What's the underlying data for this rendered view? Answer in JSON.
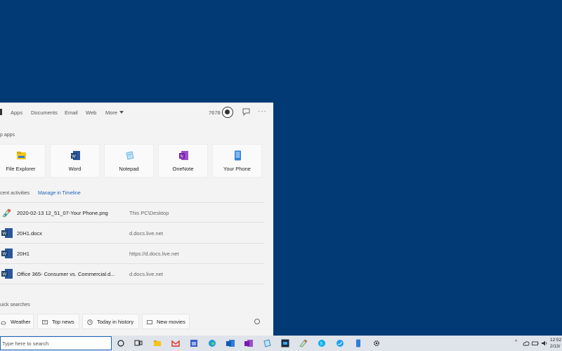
{
  "tabs": {
    "apps": "Apps",
    "documents": "Documents",
    "email": "Email",
    "web": "Web",
    "more": "More"
  },
  "header": {
    "points": "7678"
  },
  "top_apps": {
    "label": "p apps",
    "items": [
      {
        "name": "File Explorer",
        "color": "#f5c518"
      },
      {
        "name": "Word",
        "color": "#2b579a"
      },
      {
        "name": "Notepad",
        "color": "#6fb6e0"
      },
      {
        "name": "OneNote",
        "color": "#7719aa"
      },
      {
        "name": "Your Phone",
        "color": "#2f7fd6"
      }
    ]
  },
  "recent": {
    "label": "cent activities",
    "manage": "Manage in Timeline",
    "items": [
      {
        "title": "2020-02-13 12_51_07-Your Phone.png",
        "location": "This PC\\Desktop",
        "icon": "paint-icon"
      },
      {
        "title": "20H1.docx",
        "location": "d.docs.live.net",
        "icon": "word-icon"
      },
      {
        "title": "20H1",
        "location": "https://d.docs.live.net",
        "icon": "word-icon"
      },
      {
        "title": "Office 365- Consumer vs. Commercial.d...",
        "location": "d.docs.live.net",
        "icon": "word-icon"
      }
    ]
  },
  "quick": {
    "label": "uick searches",
    "items": [
      {
        "name": "Weather"
      },
      {
        "name": "Top news"
      },
      {
        "name": "Today in history"
      },
      {
        "name": "New movies"
      }
    ]
  },
  "taskbar": {
    "search_placeholder": "Type here to search",
    "clock_time": "12:52",
    "clock_date": "2/13/"
  }
}
